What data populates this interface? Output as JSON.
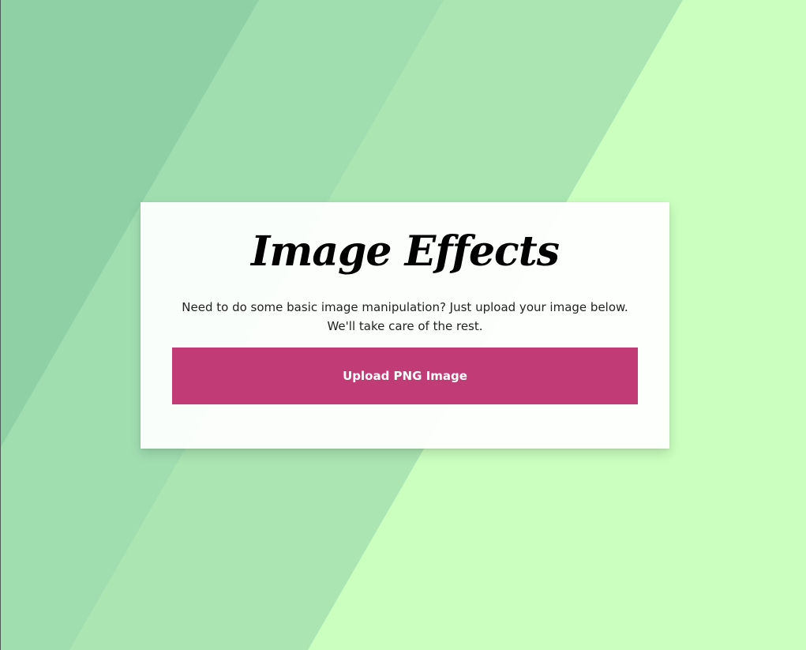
{
  "page": {
    "title": "Image Effects",
    "description": "Need to do some basic image manipulation? Just upload your image below. We'll take care of the rest.",
    "upload_button_label": "Upload PNG Image"
  },
  "colors": {
    "background_light": "#caffbf",
    "stripe_1": "#8fd1a5",
    "stripe_2": "#a0deb0",
    "stripe_3": "#abe5b2",
    "button": "#c13c76",
    "card": "#ffffff"
  }
}
